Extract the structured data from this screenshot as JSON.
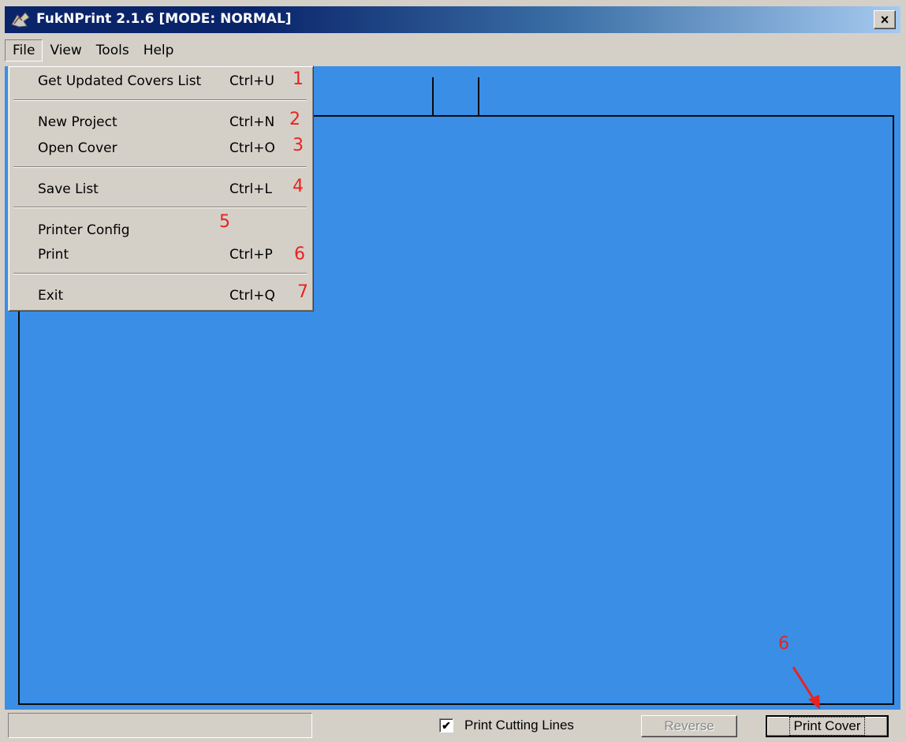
{
  "window": {
    "title": "FukNPrint  2.1.6  [MODE: NORMAL]",
    "close_label": "×"
  },
  "menubar": {
    "items": [
      {
        "label": "File",
        "active": true
      },
      {
        "label": "View"
      },
      {
        "label": "Tools"
      },
      {
        "label": "Help"
      }
    ]
  },
  "file_menu": {
    "items": [
      {
        "label": "Get Updated Covers List",
        "shortcut": "Ctrl+U",
        "annotation": "1"
      },
      {
        "label": "New Project",
        "shortcut": "Ctrl+N",
        "annotation": "2"
      },
      {
        "label": "Open Cover",
        "shortcut": "Ctrl+O",
        "annotation": "3"
      },
      {
        "label": "Save List",
        "shortcut": "Ctrl+L",
        "annotation": "4"
      },
      {
        "label": "Printer Config",
        "shortcut": "",
        "annotation": "5"
      },
      {
        "label": "Print",
        "shortcut": "Ctrl+P",
        "annotation": "6"
      },
      {
        "label": "Exit",
        "shortcut": "Ctrl+Q",
        "annotation": "7"
      }
    ]
  },
  "canvas": {
    "background": "#3a8ee6"
  },
  "statusbar": {
    "panel_text": "",
    "checkbox_label": "Print Cutting Lines",
    "checkbox_checked": true,
    "checkbox_mark": "✔",
    "reverse_label": "Reverse",
    "print_cover_label": "Print Cover"
  },
  "annotations": {
    "print_cover_marker": "6",
    "annotation_color": "#e8231f"
  }
}
